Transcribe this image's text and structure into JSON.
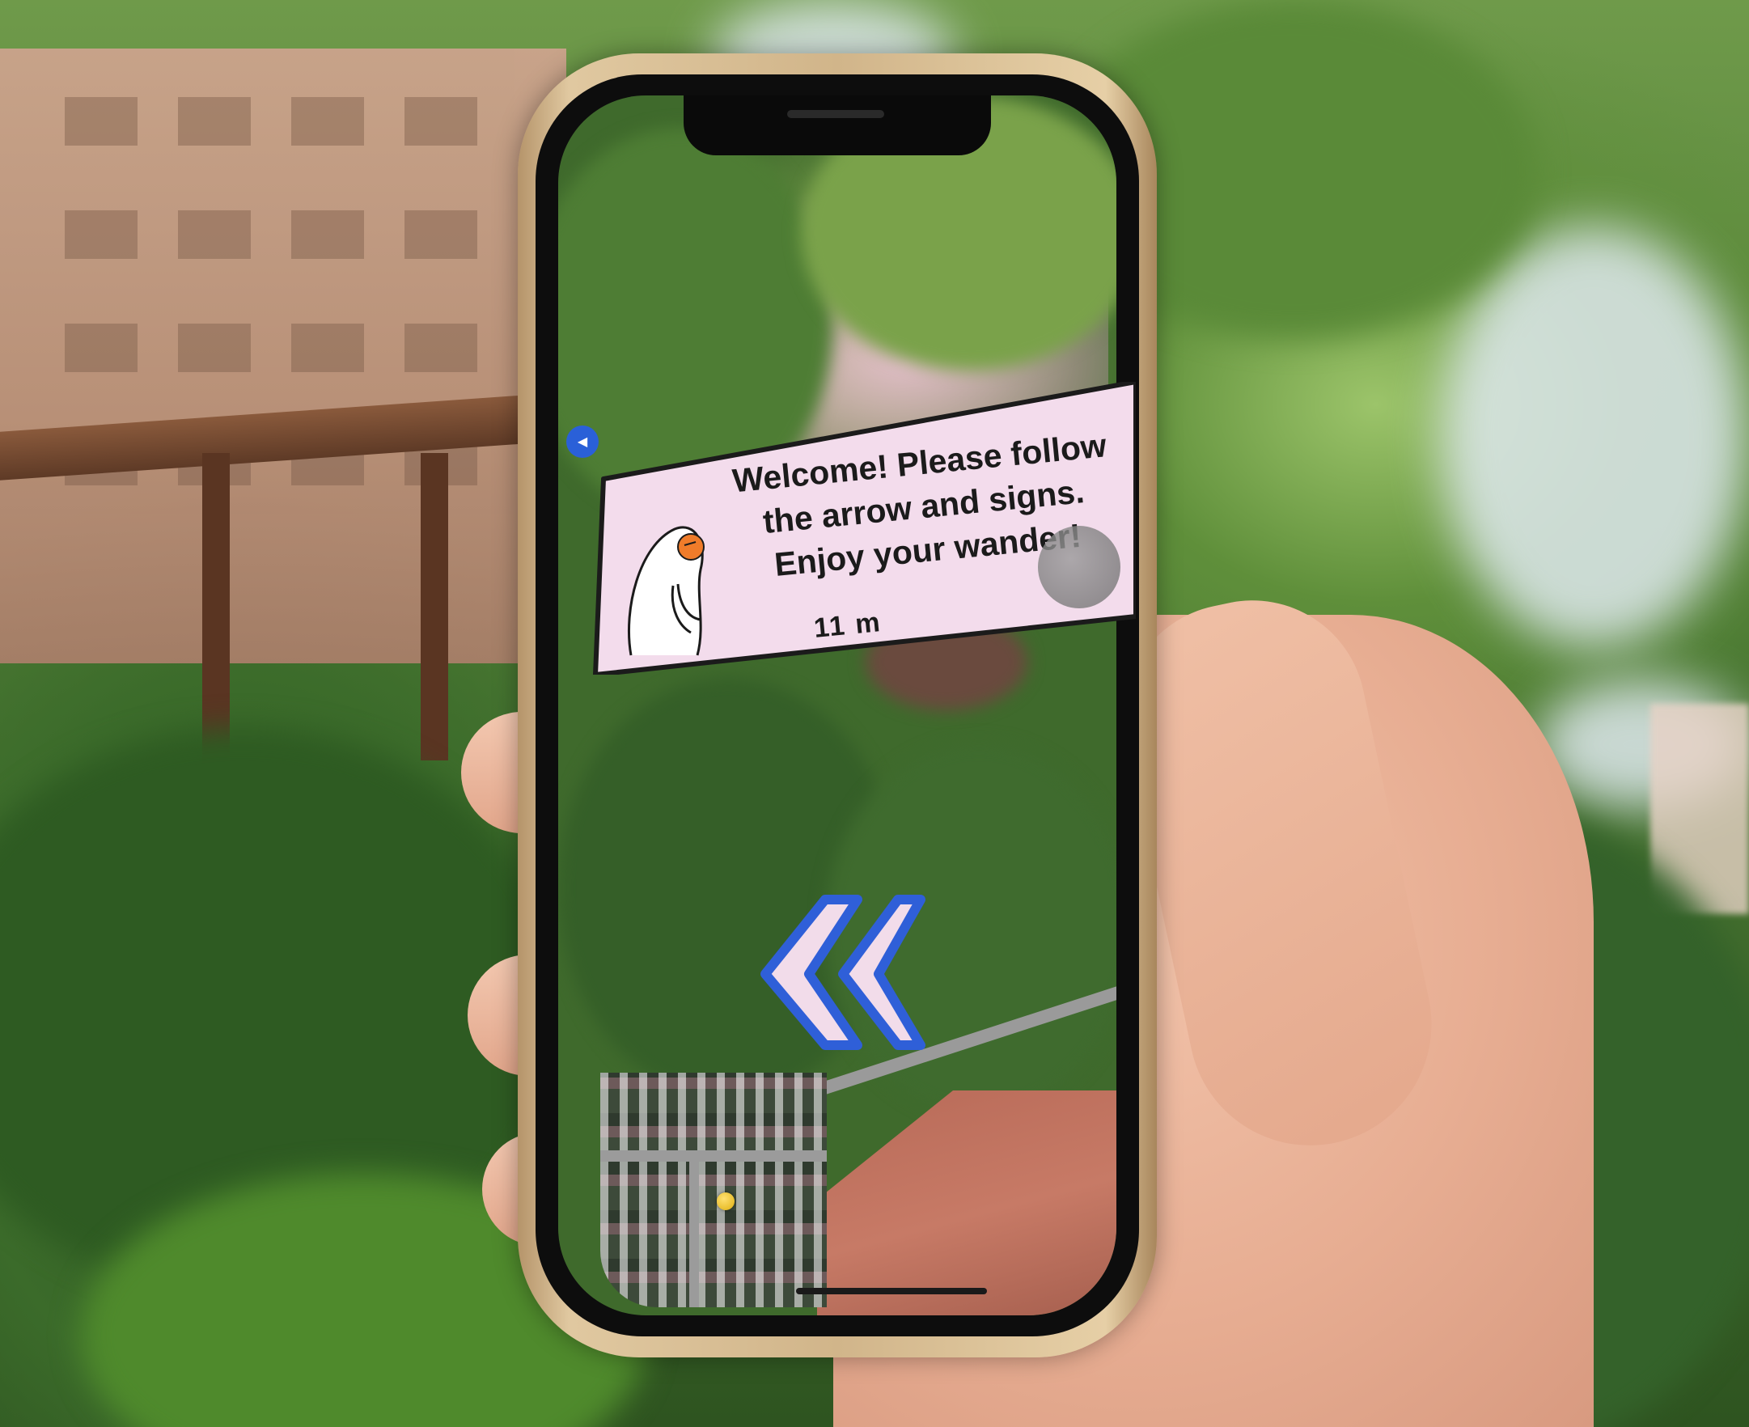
{
  "ar_sign": {
    "line1": "Welcome! Please follow",
    "line2": "the arrow and signs.",
    "line3": "Enjoy your wander!",
    "distance": "11 m"
  },
  "navigation": {
    "arrow_direction": "left",
    "arrow_color": "#2f5fd8",
    "arrow_fill": "#f2dcea"
  },
  "colors": {
    "sign_background": "#f3dcec",
    "sign_border": "#1b1b1b",
    "back_button": "#2a60d8",
    "location_marker": "#f2c21a"
  },
  "icons": {
    "back": "triangle-left-icon",
    "location": "map-marker-dot",
    "guide": "waving-mascot-icon"
  }
}
